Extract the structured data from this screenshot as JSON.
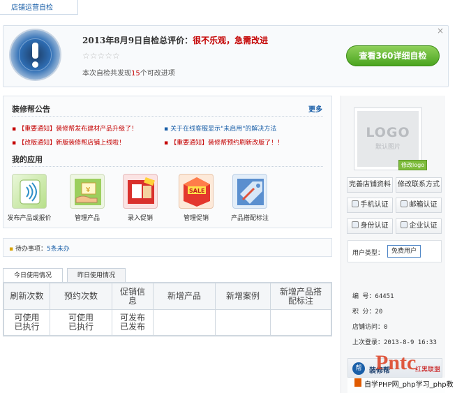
{
  "top_tab": "店铺运营自检",
  "evaluation": {
    "title_prefix": "2013年8月9日自检总评价：",
    "title_verdict": "很不乐观，急需改进",
    "stars": "☆☆☆☆☆",
    "sub_prefix": "本次自检共发现",
    "sub_count": "15",
    "sub_suffix": "个可改进项",
    "button": "查看360详细自检",
    "close": "×"
  },
  "announcements": {
    "title": "装修帮公告",
    "more": "更多",
    "items": [
      {
        "tag": "【重要通知】",
        "text": "装修帮发布建材产品升级了！",
        "color": "red"
      },
      {
        "tag": "关于在线客服显示",
        "text": "\"未启用\"的解决方法",
        "color": "blue"
      },
      {
        "tag": "【改版通知】",
        "text": "新版装修帮店铺上线啦！",
        "color": "red"
      },
      {
        "tag": "【重要通知】",
        "text": "装修帮预约刷新改版了！！",
        "color": "red"
      }
    ]
  },
  "apps": {
    "title": "我的应用",
    "items": [
      {
        "label": "发布产品或报价",
        "icon": "signal-icon"
      },
      {
        "label": "管理产品",
        "icon": "product-icon"
      },
      {
        "label": "录入促销",
        "icon": "sale-entry-icon"
      },
      {
        "label": "管理促销",
        "icon": "sale-manage-icon"
      },
      {
        "label": "产品搭配标注",
        "icon": "tag-icon"
      }
    ]
  },
  "todo": {
    "label": "待办事项：",
    "link": "5条未办"
  },
  "usage": {
    "tabs": [
      "今日使用情况",
      "昨日使用情况"
    ],
    "headers": [
      "刷新次数",
      "预约次数",
      "促销信息",
      "新增产品",
      "新增案例",
      "新增产品搭配标注"
    ],
    "row": [
      "可使用\n已执行",
      "可使用\n已执行",
      "可发布\n已发布",
      "",
      "",
      ""
    ]
  },
  "sidebar": {
    "logo_text": "LOGO",
    "logo_sub": "默认图片",
    "edit_logo": "修改logo",
    "buttons": [
      {
        "label": "完善店铺资料"
      },
      {
        "label": "修改联系方式"
      },
      {
        "label": "手机认证"
      },
      {
        "label": "邮箱认证"
      },
      {
        "label": "身份认证"
      },
      {
        "label": "企业认证"
      }
    ],
    "user_type_label": "用户类型：",
    "user_type_value": "免费用户",
    "info": [
      {
        "k": "编    号：",
        "v": "64451"
      },
      {
        "k": "积    分：",
        "v": "20"
      },
      {
        "k": "店铺访问：",
        "v": "0"
      },
      {
        "k": "上次登录：",
        "v": "2013-8-9 16:33"
      }
    ]
  },
  "footer": {
    "badge": "帮",
    "brand": "装修帮",
    "red_text": "红黑联盟",
    "watermark_big": "Pntc",
    "watermark": "自学PHP网_php学习_php教"
  },
  "colors": {
    "accent_red": "#c40000",
    "link_blue": "#1a5fa8",
    "button_green": "#4aa41f"
  }
}
